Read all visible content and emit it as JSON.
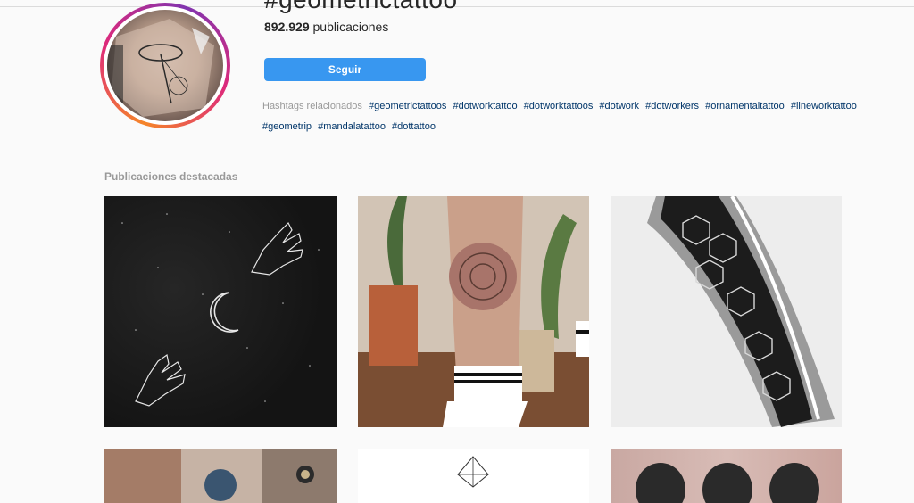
{
  "profile": {
    "hashtag_title": "#geometrictattoo",
    "post_count": "892.929",
    "post_count_suffix": "publicaciones",
    "follow_label": "Seguir"
  },
  "related": {
    "label": "Hashtags relacionados",
    "tags": [
      "#geometrictattoos",
      "#dotworktattoo",
      "#dotworktattoos",
      "#dotwork",
      "#dotworkers",
      "#ornamentaltattoo",
      "#lineworktattoo",
      "#geometrip",
      "#mandalatattoo",
      "#dottattoo"
    ]
  },
  "featured": {
    "title": "Publicaciones destacadas"
  },
  "colors": {
    "accent": "#3897f0",
    "hashtag_link": "#003569",
    "muted": "#999999",
    "background": "#fafafa"
  }
}
